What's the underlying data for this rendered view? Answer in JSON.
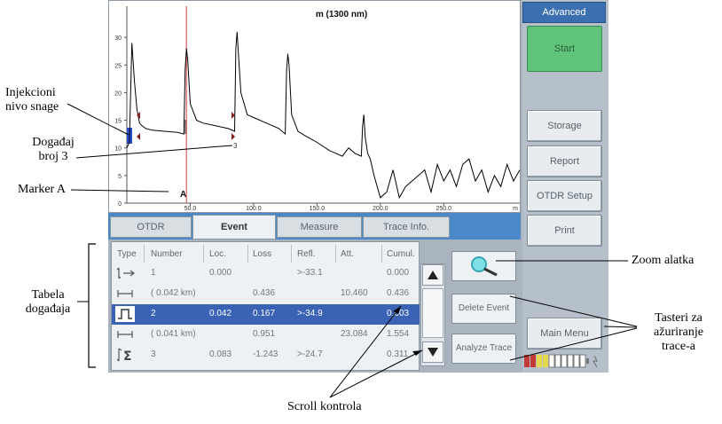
{
  "chart": {
    "title": "m (1300 nm)",
    "y_ticks": [
      "0",
      "5",
      "10",
      "15",
      "20",
      "25",
      "30"
    ],
    "x_ticks": [
      "50.0",
      "100.0",
      "150.0",
      "200.0",
      "250.0"
    ],
    "x_unit": "m",
    "event_label": "3",
    "marker_label": "A"
  },
  "chart_data": {
    "type": "line",
    "title": "m (1300 nm)",
    "xlabel": "m",
    "ylabel": "",
    "xlim": [
      0,
      310
    ],
    "ylim": [
      0,
      35
    ],
    "x_ticks": [
      50,
      100,
      150,
      200,
      250
    ],
    "y_ticks": [
      0,
      5,
      10,
      15,
      20,
      25,
      30
    ],
    "grid": false,
    "series": [
      {
        "x": [
          0,
          2,
          4,
          6,
          8,
          10,
          12,
          15,
          20,
          30,
          40,
          45,
          46,
          47,
          48,
          50,
          55,
          60,
          70,
          80,
          85,
          86,
          87,
          88,
          90,
          95,
          100,
          110,
          120,
          125,
          126,
          127,
          128,
          130,
          135,
          140,
          150,
          160,
          165,
          170,
          175,
          180,
          185,
          186,
          187,
          188,
          190,
          192,
          195,
          200,
          205,
          210,
          215,
          220,
          225,
          230,
          235,
          240,
          245,
          250,
          255,
          260,
          265,
          270,
          275,
          280,
          285,
          290,
          295,
          300,
          305,
          310
        ],
        "y": [
          10,
          11,
          29,
          22,
          17,
          14.5,
          14,
          13.5,
          13.2,
          13,
          12.8,
          12.5,
          24,
          28,
          26,
          18,
          15,
          14.5,
          14,
          13.5,
          13,
          28,
          31,
          27,
          20,
          16,
          15.5,
          14.5,
          13.5,
          12.5,
          24,
          27,
          25,
          16,
          13,
          12.3,
          11,
          9.5,
          9,
          8.5,
          10,
          9,
          8.5,
          14,
          16,
          12,
          9,
          8,
          5,
          1,
          2,
          6,
          1,
          3,
          4,
          5,
          6,
          2,
          7,
          4,
          6,
          3,
          7,
          8,
          4,
          6,
          2,
          5,
          3,
          7,
          4,
          6
        ]
      }
    ],
    "markers": [
      {
        "label": "A",
        "x": 47
      }
    ],
    "events": [
      {
        "label": "3",
        "x": 87
      }
    ]
  },
  "right_panel": {
    "advanced": "Advanced",
    "start": "Start",
    "storage": "Storage",
    "report": "Report",
    "otdr_setup": "OTDR Setup",
    "print": "Print",
    "main_menu": "Main Menu"
  },
  "tabs": [
    "OTDR",
    "Event",
    "Measure",
    "Trace Info."
  ],
  "table": {
    "headers": [
      "Type",
      "Number",
      "Loc.",
      "Loss",
      "Refl.",
      "Att.",
      "Cumul."
    ],
    "rows": [
      {
        "type_icon": "launch-icon",
        "number": "1",
        "loc": "0.000",
        "loss": "",
        "refl": ">-33.1",
        "att": "",
        "cumul": "0.000",
        "selected": false
      },
      {
        "type_icon": "span-icon",
        "number": "( 0.042 km)",
        "loc": "",
        "loss": "0.436",
        "refl": "",
        "att": "10.460",
        "cumul": "0.436",
        "selected": false
      },
      {
        "type_icon": "reflective-event-icon",
        "number": "2",
        "loc": "0.042",
        "loss": "0.167",
        "refl": ">-34.9",
        "att": "",
        "cumul": "0.603",
        "selected": true
      },
      {
        "type_icon": "span-icon",
        "number": "( 0.041 km)",
        "loc": "",
        "loss": "0.951",
        "refl": "",
        "att": "23.084",
        "cumul": "1.554",
        "selected": false
      },
      {
        "type_icon": "end-sum-icon",
        "number": "3",
        "loc": "0.083",
        "loss": "-1.243",
        "refl": ">-24.7",
        "att": "",
        "cumul": "0.311",
        "selected": false
      }
    ]
  },
  "tools": {
    "zoom_icon": "magnifier-icon",
    "delete_event": "Delete Event",
    "analyze_trace": "Analyze Trace"
  },
  "battery": {
    "icon": "battery-icon"
  },
  "annotations": {
    "injection_level": "Injekcioni nivo snage",
    "event_3": "Događaj broj 3",
    "marker_a": "Marker A",
    "events_table": "Tabela događaja",
    "zoom_tool": "Zoom alatka",
    "update_buttons": "Tasteri za ažuriranje trace-a",
    "scroll_control": "Scroll kontrola"
  },
  "colors": {
    "start_green": "#5fc47a",
    "advanced_blue": "#3c6fb0",
    "selected_row": "#3a62b5",
    "marker_red": "#d23a3a",
    "trace": "#000000"
  }
}
